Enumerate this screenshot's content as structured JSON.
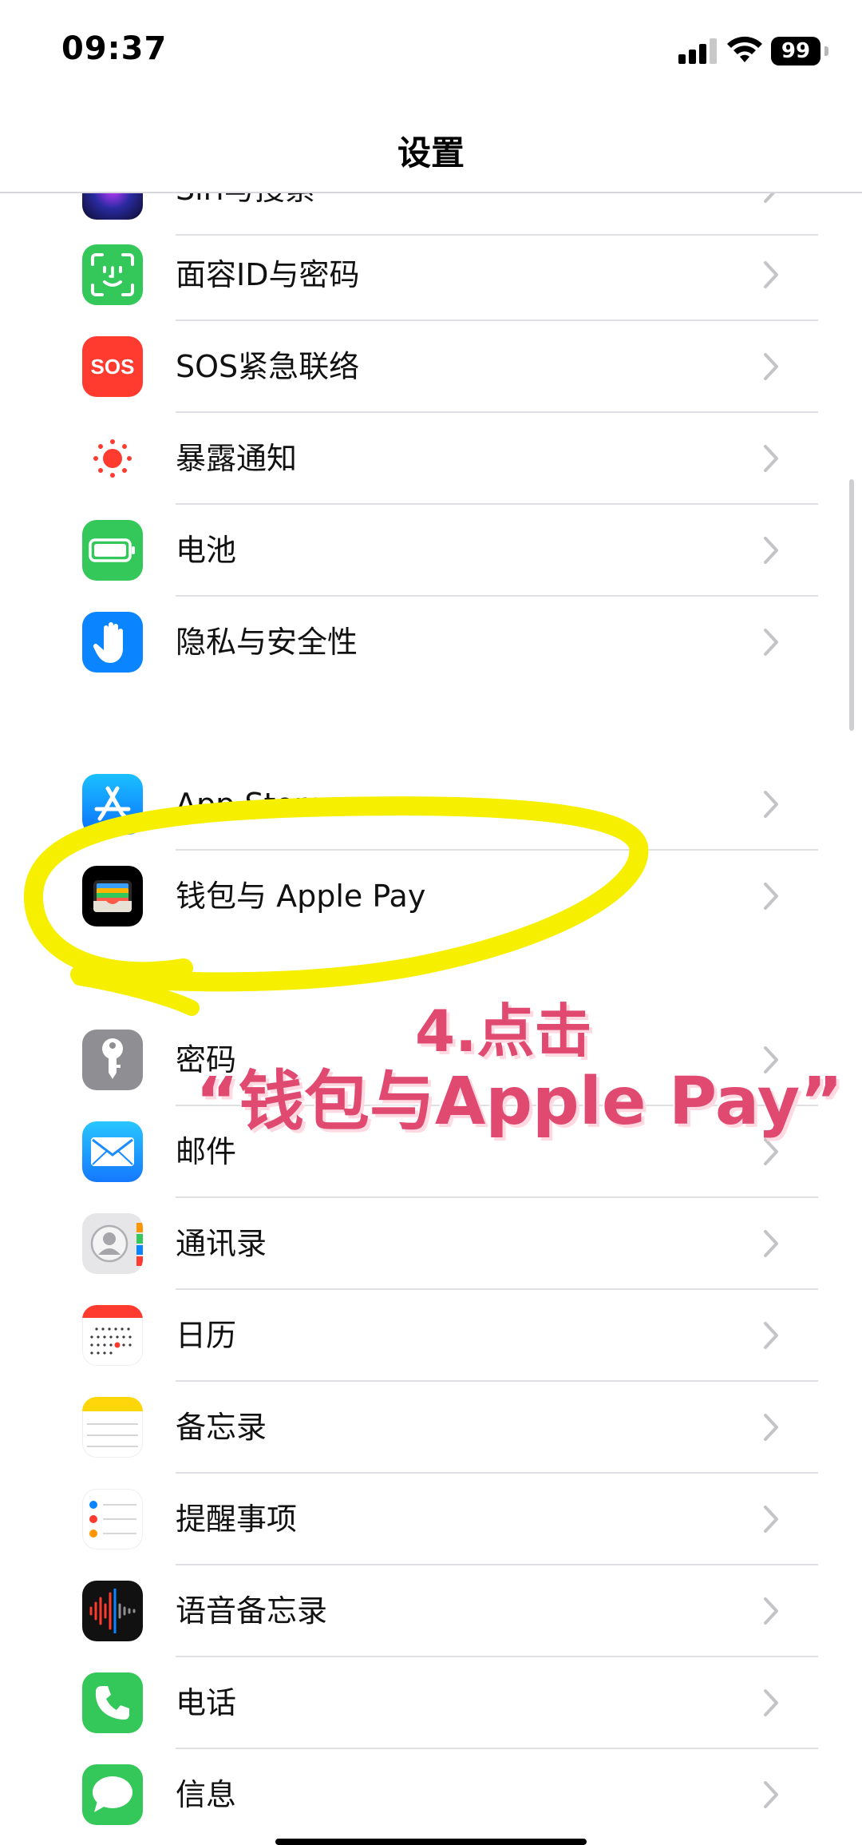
{
  "status_bar": {
    "time": "09:37",
    "battery": "99"
  },
  "nav": {
    "title": "设置"
  },
  "rows": [
    {
      "label": "Siri与搜索",
      "icon": "siri-icon"
    },
    {
      "label": "面容ID与密码",
      "icon": "faceid-icon"
    },
    {
      "label": "SOS紧急联络",
      "icon": "sos-icon"
    },
    {
      "label": "暴露通知",
      "icon": "exposure-notification-icon"
    },
    {
      "label": "电池",
      "icon": "battery-icon"
    },
    {
      "label": "隐私与安全性",
      "icon": "hand-icon"
    },
    {
      "label": "App Store",
      "icon": "app-store-icon"
    },
    {
      "label": "钱包与 Apple Pay",
      "icon": "wallet-icon"
    },
    {
      "label": "密码",
      "icon": "key-icon"
    },
    {
      "label": "邮件",
      "icon": "mail-icon"
    },
    {
      "label": "通讯录",
      "icon": "contacts-icon"
    },
    {
      "label": "日历",
      "icon": "calendar-icon"
    },
    {
      "label": "备忘录",
      "icon": "notes-icon"
    },
    {
      "label": "提醒事项",
      "icon": "reminders-icon"
    },
    {
      "label": "语音备忘录",
      "icon": "voice-memos-icon"
    },
    {
      "label": "电话",
      "icon": "phone-icon"
    },
    {
      "label": "信息",
      "icon": "messages-icon"
    }
  ],
  "annotation": {
    "step": "4.点击",
    "target": "“钱包与Apple Pay”"
  },
  "colors": {
    "highlight": "#f6f000",
    "annotation_text": "#e14a70"
  }
}
